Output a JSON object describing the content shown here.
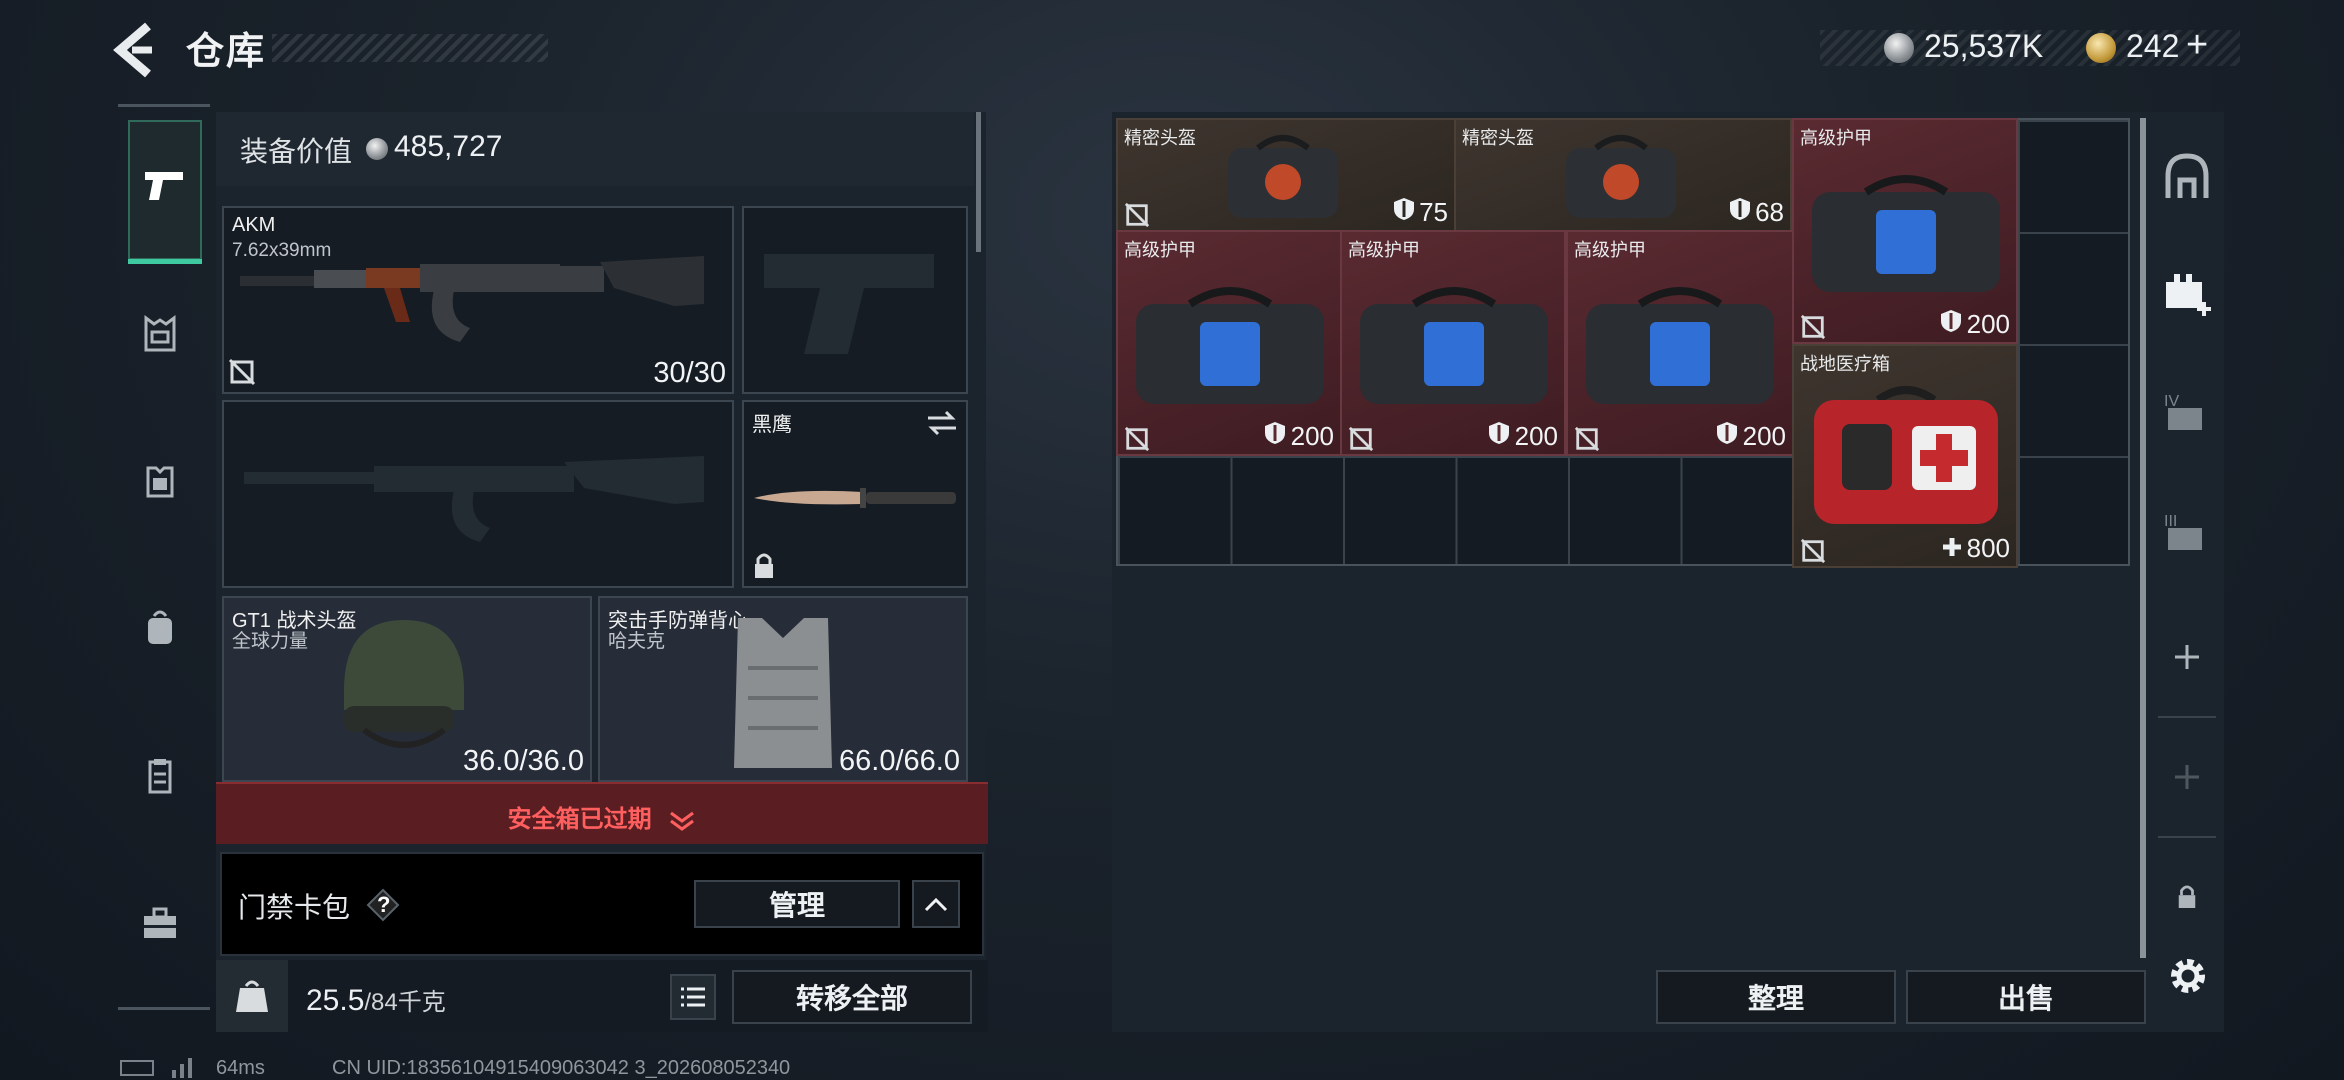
{
  "header": {
    "title": "仓库",
    "currency_silver": "25,537K",
    "currency_gold": "242",
    "currency_gold_add": "+"
  },
  "sidebar": {
    "items": [
      {
        "icon": "pistol-icon",
        "active": true
      },
      {
        "icon": "chest-rig-icon"
      },
      {
        "icon": "armor-vest-icon"
      },
      {
        "icon": "backpack-icon"
      },
      {
        "icon": "clipboard-icon"
      },
      {
        "icon": "briefcase-icon"
      }
    ]
  },
  "equipment": {
    "value_label": "装备价值",
    "value": "485,727",
    "primary_weapon": {
      "name": "AKM",
      "caliber": "7.62x39mm",
      "ammo": "30/30"
    },
    "melee": {
      "name": "黑鹰"
    },
    "helmet": {
      "name": "GT1 战术头盔",
      "brand": "全球力量",
      "durability": "36.0/36.0"
    },
    "vest": {
      "name": "突击手防弹背心",
      "brand": "哈夫克",
      "durability": "66.0/66.0"
    },
    "safebox_text": "安全箱已过期",
    "cardpack_label": "门禁卡包",
    "cardpack_help": "?",
    "manage_label": "管理",
    "weight": "25.5",
    "weight_max": "/84千克",
    "transfer_all_label": "转移全部"
  },
  "storage": {
    "items": [
      {
        "name": "精密头盔",
        "value": "75",
        "color": "#3e352e"
      },
      {
        "name": "精密头盔",
        "value": "68",
        "color": "#3e352e"
      },
      {
        "name": "高级护甲",
        "value": "200",
        "color": "#5a2a31"
      },
      {
        "name": "高级护甲",
        "value": "200",
        "color": "#5a2a31"
      },
      {
        "name": "高级护甲",
        "value": "200",
        "color": "#5a2a31"
      },
      {
        "name": "高级护甲",
        "value": "200",
        "color": "#5a2a31"
      },
      {
        "name": "战地医疗箱",
        "value": "800",
        "color": "#3e352e"
      }
    ],
    "sort_label": "整理",
    "sell_label": "出售"
  },
  "footer": {
    "ping": "64ms",
    "uid": "CN UID:18356104915409063042 3_202608052340"
  }
}
